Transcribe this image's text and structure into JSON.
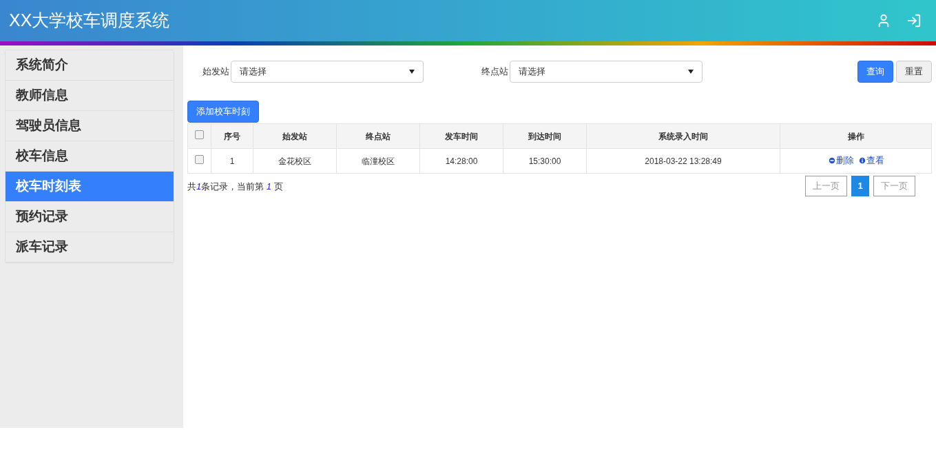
{
  "header": {
    "title": "XX大学校车调度系统"
  },
  "sidebar": {
    "items": [
      {
        "label": "系统简介",
        "selected": false
      },
      {
        "label": "教师信息",
        "selected": false
      },
      {
        "label": "驾驶员信息",
        "selected": false
      },
      {
        "label": "校车信息",
        "selected": false
      },
      {
        "label": "校车时刻表",
        "selected": true
      },
      {
        "label": "预约记录",
        "selected": false
      },
      {
        "label": "派车记录",
        "selected": false
      }
    ]
  },
  "filters": [
    {
      "label": "始发站",
      "value": "请选择"
    },
    {
      "label": "终点站",
      "value": "请选择"
    }
  ],
  "buttons": {
    "query": "查询",
    "reset": "重置",
    "add": "添加校车时刻"
  },
  "table": {
    "header_checked": false,
    "columns": [
      "序号",
      "始发站",
      "终点站",
      "发车时间",
      "到达时间",
      "系统录入时间",
      "操作"
    ],
    "rows": [
      {
        "checked": false,
        "cells": [
          "1",
          "金花校区",
          "临潼校区",
          "14:28:00",
          "15:30:00",
          "2018-03-22 13:28:49"
        ],
        "actions": [
          "删除",
          "查看"
        ]
      }
    ]
  },
  "summary": {
    "prefix": "共",
    "total": "1",
    "middle": "条记录，当前第 ",
    "page": "1",
    "suffix": " 页"
  },
  "pagination": {
    "prev": {
      "label": "上一页",
      "disabled": true
    },
    "pages": [
      {
        "label": "1",
        "selected": true
      }
    ],
    "next": {
      "label": "下一页",
      "disabled": true
    }
  }
}
